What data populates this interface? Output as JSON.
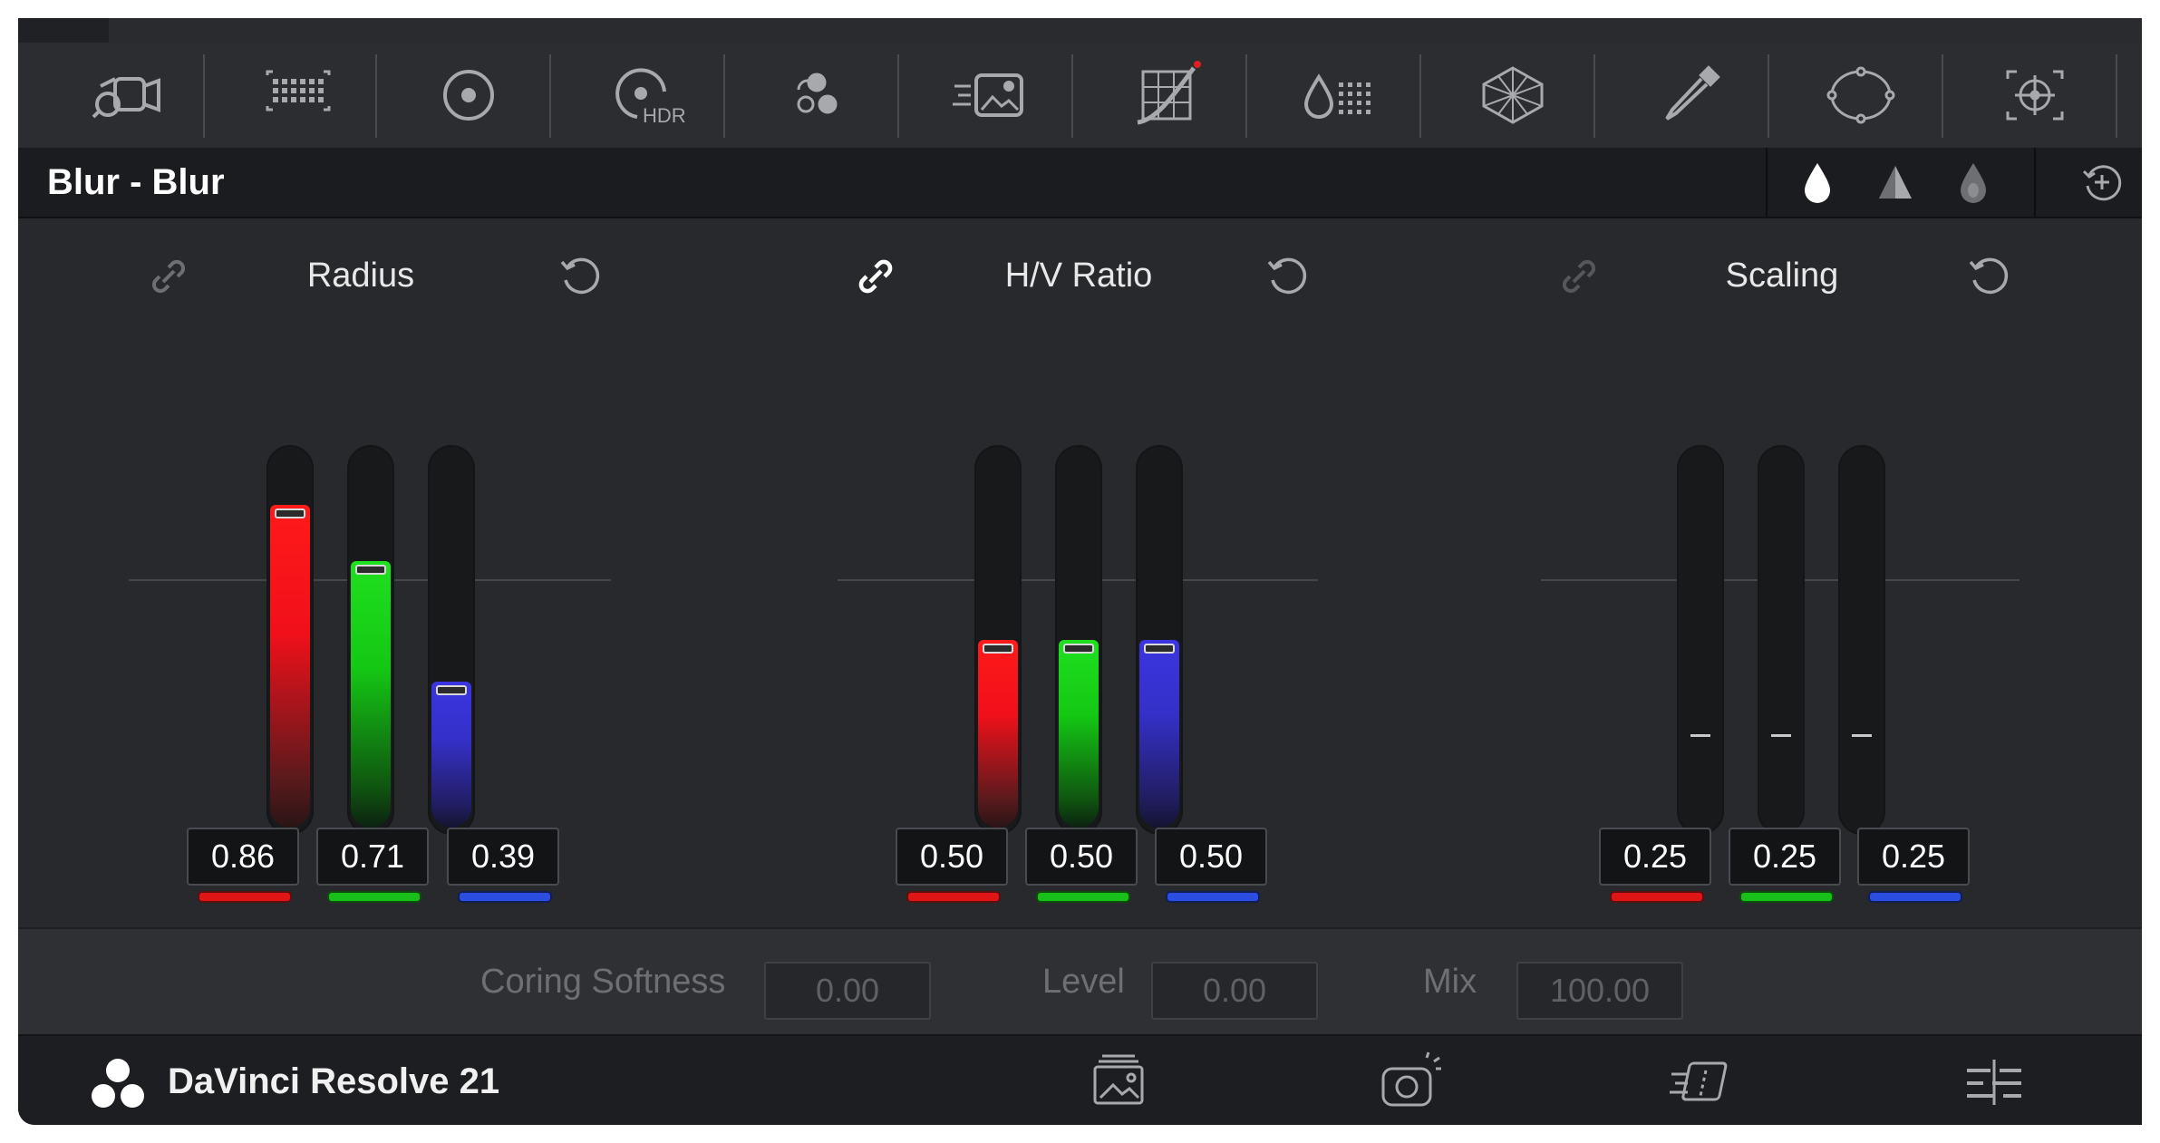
{
  "toolbar": {
    "icons": [
      "camera-raw-icon",
      "color-match-icon",
      "color-wheels-icon",
      "hdr-wheels-icon",
      "rgb-mixer-icon",
      "motion-effects-icon",
      "curves-icon",
      "color-warper-icon",
      "qualifier-icon",
      "window-icon",
      "tracker-icon",
      "magic-mask-icon"
    ],
    "hdr_label": "HDR",
    "curves_indicator_color": "#e02020"
  },
  "panel": {
    "title": "Blur - Blur",
    "modes": [
      "blur-mode-icon",
      "sharpen-mode-icon",
      "mist-mode-icon"
    ],
    "reset_all_icon": "reset-all-icon"
  },
  "groups": [
    {
      "title": "Radius",
      "linked": false,
      "values": {
        "red": "0.86",
        "green": "0.71",
        "blue": "0.39"
      },
      "levels": [
        0.86,
        0.71,
        0.39
      ]
    },
    {
      "title": "H/V Ratio",
      "linked": true,
      "values": {
        "red": "0.50",
        "green": "0.50",
        "blue": "0.50"
      },
      "levels": [
        0.5,
        0.5,
        0.5
      ]
    },
    {
      "title": "Scaling",
      "linked": false,
      "values": {
        "red": "0.25",
        "green": "0.25",
        "blue": "0.25"
      },
      "levels": [
        0.25,
        0.25,
        0.25
      ],
      "disabled": true
    }
  ],
  "params": {
    "coring_softness": {
      "label": "Coring Softness",
      "value": "0.00"
    },
    "level": {
      "label": "Level",
      "value": "0.00"
    },
    "mix": {
      "label": "Mix",
      "value": "100.00"
    }
  },
  "footer": {
    "brand": "DaVinci Resolve 21",
    "icons": [
      "media-page-icon",
      "color-page-icon",
      "edit-page-icon",
      "fairlight-page-icon"
    ]
  },
  "colors": {
    "red": "#e01515",
    "green": "#19c019",
    "blue": "#2b4ee0",
    "background": "#28292d"
  }
}
